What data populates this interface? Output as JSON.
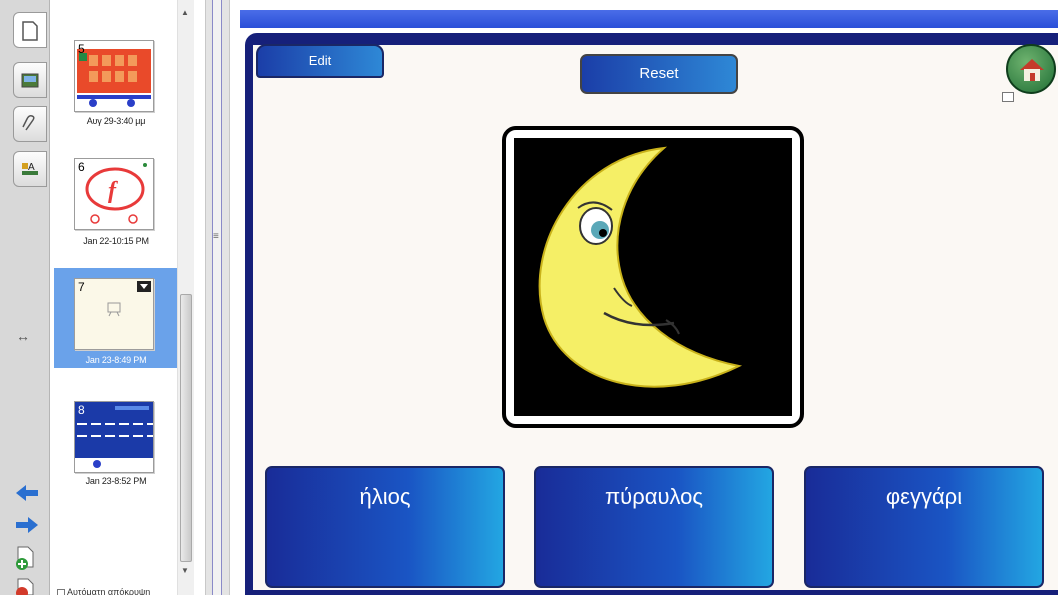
{
  "sorter": {
    "pages": [
      {
        "num": "5",
        "caption": "Αυγ 29-3:40 μμ",
        "selected": false
      },
      {
        "num": "6",
        "caption": "Jan 22-10:15 PM",
        "selected": false
      },
      {
        "num": "7",
        "caption": "Jan 23-8:49 PM",
        "selected": true
      },
      {
        "num": "8",
        "caption": "Jan 23-8:52 PM",
        "selected": false
      }
    ],
    "bottom_checkbox": "Αυτόματη απόκρυψη"
  },
  "page": {
    "edit_label": "Edit",
    "reset_label": "Reset",
    "answers": [
      "ήλιος",
      "πύραυλος",
      "φεγγάρι"
    ]
  },
  "colors": {
    "frame": "#16207a",
    "button_start": "#192c98",
    "button_end": "#23a6e2",
    "moon": "#f5ef66",
    "selected_thumb": "#6aa2ea"
  }
}
